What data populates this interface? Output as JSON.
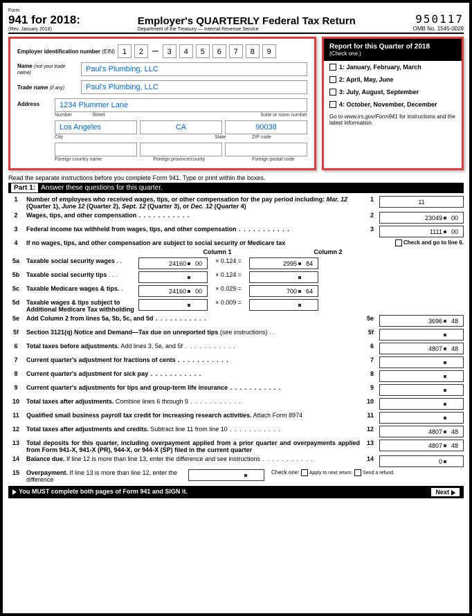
{
  "header": {
    "form": "Form",
    "rev": "(Rev. January 2018)",
    "title": "941 for 2018:",
    "main": "Employer's QUARTERLY Federal Tax Return",
    "dept": "Department of the Treasury — Internal Revenue Service",
    "code": "950117",
    "omb": "OMB No. 1545-0029"
  },
  "emp": {
    "einLabel": "Employer identification number",
    "einAbbr": "(EIN)",
    "ein": [
      "1",
      "2",
      "3",
      "4",
      "5",
      "6",
      "7",
      "8",
      "9"
    ],
    "nameLabel": "Name",
    "nameNote": "(not your trade name)",
    "name": "Paul's Plumbing, LLC",
    "tradeLabel": "Trade name",
    "tradeNote": "(if any)",
    "trade": "Paul's Plumbing, LLC",
    "addrLabel": "Address",
    "street": "1234 Plummer Lane",
    "city": "Los Angeles",
    "state": "CA",
    "zip": "90038",
    "sublbls": {
      "number": "Number",
      "street": "Street",
      "suite": "Suite or room number",
      "city": "City",
      "state": "State",
      "zip": "ZIP code",
      "fcountry": "Foreign country name",
      "fprov": "Foreign province/county",
      "fpostal": "Foreign postal code"
    }
  },
  "quarter": {
    "title": "Report for this Quarter of 2018",
    "sub": "(Check one.)",
    "opts": [
      "1: January, February, March",
      "2: April, May, June",
      "3: July, August, September",
      "4: October, November, December"
    ],
    "foot1": "Go to ",
    "footItal": "www.irs.gov/Form941",
    "foot2": " for instructions and the latest information."
  },
  "sep": "Read the separate instructions before you complete Form 941. Type or print within the boxes.",
  "part1": {
    "label": "Part 1:",
    "title": "Answer these questions for this quarter."
  },
  "lines": {
    "l1": {
      "n": "1",
      "t": "Number of employees who received wages, tips, or other compensation for the pay period including: ",
      "b": "Mar. 12",
      "t2": " (Quarter 1), ",
      "b2": "June 12",
      "t3": " (Quarter 2), ",
      "b3": "Sept. 12",
      "t4": " (Quarter 3), or ",
      "b4": "Dec. 12",
      "t5": " (Quarter 4)",
      "r": "1",
      "v": "11"
    },
    "l2": {
      "n": "2",
      "t": "Wages, tips, and other compensation",
      "r": "2",
      "d": "23049",
      "c": "00"
    },
    "l3": {
      "n": "3",
      "t": "Federal income tax withheld from wages, tips, and other compensation",
      "r": "3",
      "d": "1111",
      "c": "00"
    },
    "l4": {
      "n": "4",
      "t": "If no wages, tips, and other compensation are subject to social security or Medicare tax",
      "chk": "Check and go to line 6."
    },
    "col1": "Column 1",
    "col2": "Column 2",
    "l5a": {
      "n": "5a",
      "t": "Taxable social security wages",
      "d1": "24160",
      "c1": "00",
      "m": "× 0.124 =",
      "d2": "2995",
      "c2": "84"
    },
    "l5b": {
      "n": "5b",
      "t": "Taxable social security tips",
      "m": "× 0.124 ="
    },
    "l5c": {
      "n": "5c",
      "t": "Taxable Medicare wages & tips.",
      "d1": "24160",
      "c1": "00",
      "m": "× 0.029 =",
      "d2": "700",
      "c2": "64"
    },
    "l5d": {
      "n": "5d",
      "t": "Taxable wages & tips subject to Additional Medicare Tax withholding",
      "m": "× 0.009 ="
    },
    "l5e": {
      "n": "5e",
      "t": "Add Column 2 from lines 5a, 5b, 5c, and 5d",
      "r": "5e",
      "d": "3696",
      "c": "48"
    },
    "l5f": {
      "n": "5f",
      "t": "Section 3121(q) Notice and Demand—Tax due on unreported tips ",
      "note": "(see instructions)",
      "r": "5f"
    },
    "l6": {
      "n": "6",
      "t": "Total taxes before adjustments.",
      "t2": " Add lines 3, 5e, and 5f",
      "r": "6",
      "d": "4807",
      "c": "48"
    },
    "l7": {
      "n": "7",
      "t": "Current quarter's adjustment for fractions of cents",
      "r": "7"
    },
    "l8": {
      "n": "8",
      "t": "Current quarter's adjustment for sick pay",
      "r": "8"
    },
    "l9": {
      "n": "9",
      "t": "Current quarter's adjustments for tips and group-term life insurance",
      "r": "9"
    },
    "l10": {
      "n": "10",
      "t": "Total taxes after adjustments.",
      "t2": " Combine lines 6 through 9",
      "r": "10"
    },
    "l11": {
      "n": "11",
      "t": "Qualified small business payroll tax credit for increasing research activities.",
      "t2": " Attach Form 8974",
      "r": "11"
    },
    "l12": {
      "n": "12",
      "t": "Total taxes after adjustments and credits.",
      "t2": " Subtract line 11 from line 10",
      "r": "12",
      "d": "4807",
      "c": "48"
    },
    "l13": {
      "n": "13",
      "t": "Total deposits for this quarter, including overpayment applied from a prior quarter and overpayments applied from Form 941-X, 941-X (PR), 944-X, or 944-X (SP) filed in the current quarter",
      "r": "13",
      "d": "4807",
      "c": "48"
    },
    "l14": {
      "n": "14",
      "t": "Balance due.",
      "t2": " If line 12 is more than line 13, enter the difference and see instructions",
      "r": "14",
      "d": "0"
    },
    "l15": {
      "n": "15",
      "t": "Overpayment.",
      "t2": " If line 13 is more than line 12, enter the difference",
      "chk": "Check one:",
      "o1": "Apply to next return.",
      "o2": "Send a refund."
    }
  },
  "footer": {
    "l": "You MUST complete both pages of Form 941 and SIGN it.",
    "r": "Next"
  }
}
